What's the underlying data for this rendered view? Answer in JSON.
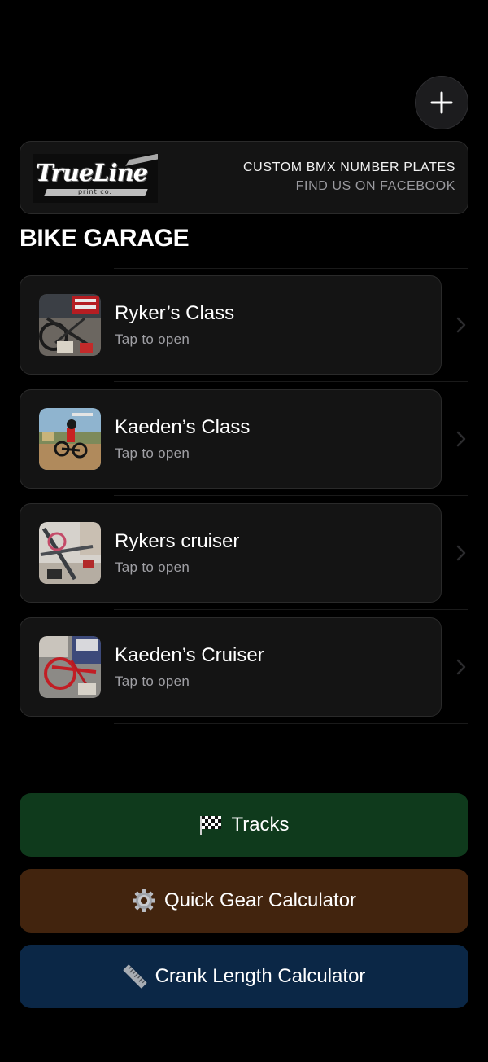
{
  "header": {
    "add_label": "+"
  },
  "sponsor": {
    "logo_text": "TrueLine",
    "logo_subtext": "print co.",
    "line1": "CUSTOM BMX NUMBER PLATES",
    "line2": "FIND US ON FACEBOOK"
  },
  "page": {
    "title": "BIKE GARAGE"
  },
  "bikes": [
    {
      "name": "Ryker’s Class",
      "subtitle": "Tap to open"
    },
    {
      "name": "Kaeden’s Class",
      "subtitle": "Tap to open"
    },
    {
      "name": "Rykers cruiser",
      "subtitle": "Tap to open"
    },
    {
      "name": "Kaeden’s Cruiser",
      "subtitle": "Tap to open"
    }
  ],
  "actions": {
    "tracks": {
      "label": "Tracks",
      "icon": "checkered-flag-icon",
      "color": "#0f3a1c"
    },
    "gear": {
      "label": "Quick Gear Calculator",
      "icon": "gear-icon",
      "color": "#42240e"
    },
    "crank": {
      "label": "Crank Length Calculator",
      "icon": "ruler-icon",
      "color": "#0b2746"
    }
  }
}
